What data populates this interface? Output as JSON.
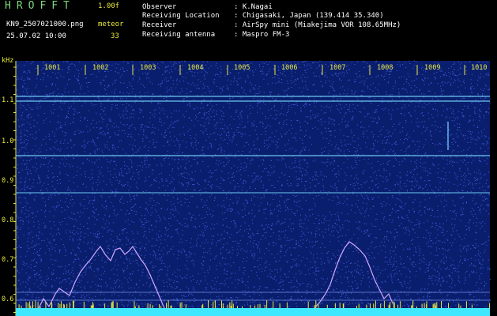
{
  "header": {
    "app_name": "HROFFT",
    "version": "1.00f",
    "filename": "KN9_2507021000.png",
    "mode": "meteor",
    "datetime": "25.07.02 10:00",
    "count": "33",
    "info_labels": [
      "Observer",
      "Receiving Location",
      "Receiver",
      "Receiving antenna"
    ],
    "info_values": [
      ": K.Nagai",
      ": Chigasaki, Japan (139.414 35.340)",
      ": AirSpy mini (Miakejima VOR 108.65MHz)",
      ": Maspro FM-3"
    ]
  },
  "plot": {
    "y_unit": "kHz",
    "y_ticks": [
      "1.1",
      "1.0",
      "0.9",
      "0.8",
      "0.7",
      "0.6"
    ],
    "x_ticks": [
      "1001",
      "1002",
      "1003",
      "1004",
      "1005",
      "1006",
      "1007",
      "1008",
      "1009",
      "1010"
    ],
    "colors": {
      "background": "#0a1e6e",
      "noise": "#3c5ad2",
      "carrier": "#78dcff",
      "axis": "#e8e840",
      "trace": "#d0a8ff",
      "baseline": "#40e8ff"
    }
  }
}
